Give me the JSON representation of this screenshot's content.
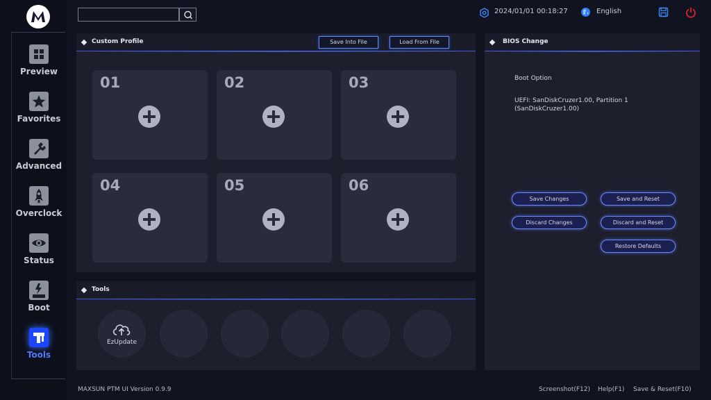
{
  "app": {
    "version_text": "MAXSUN PTM UI Version 0.9.9"
  },
  "top_bar": {
    "search_placeholder": "",
    "datetime": "2024/01/01 00:18:27",
    "language": "English"
  },
  "sidebar": {
    "items": [
      {
        "label": "Preview",
        "icon": "grid-icon",
        "active": false
      },
      {
        "label": "Favorites",
        "icon": "star-icon",
        "active": false
      },
      {
        "label": "Advanced",
        "icon": "wrench-icon",
        "active": false
      },
      {
        "label": "Overclock",
        "icon": "rocket-icon",
        "active": false
      },
      {
        "label": "Status",
        "icon": "eye-icon",
        "active": false
      },
      {
        "label": "Boot",
        "icon": "ssd-icon",
        "active": false
      },
      {
        "label": "Tools",
        "icon": "tools-icon",
        "active": true
      }
    ]
  },
  "custom_profile": {
    "title": "Custom Profile",
    "save_label": "Save Into File",
    "load_label": "Load From File",
    "slots": [
      "01",
      "02",
      "03",
      "04",
      "05",
      "06"
    ]
  },
  "tools": {
    "title": "Tools",
    "items": [
      {
        "label": "EzUpdate",
        "icon": "cloud-upload-icon"
      },
      {
        "label": "",
        "icon": ""
      },
      {
        "label": "",
        "icon": ""
      },
      {
        "label": "",
        "icon": ""
      },
      {
        "label": "",
        "icon": ""
      },
      {
        "label": "",
        "icon": ""
      }
    ]
  },
  "bios_change": {
    "title": "BIOS Change",
    "option_label": "Boot Option",
    "option_value_line1": "UEFI: SanDiskCruzer1.00, Partition 1",
    "option_value_line2": "(SanDiskCruzer1.00)",
    "buttons": {
      "save_changes": "Save Changes",
      "save_and_reset": "Save and Reset",
      "discard_changes": "Discard Changes",
      "discard_and_reset": "Discard and Reset",
      "restore_defaults": "Restore Defaults"
    }
  },
  "footer": {
    "screenshot": "Screenshot(F12)",
    "help": "Help(F1)",
    "save_reset": "Save & Reset(F10)"
  },
  "colors": {
    "accent": "#3b6cff",
    "background": "#111320",
    "panel": "#1d1f2d",
    "power": "#e0242b"
  }
}
